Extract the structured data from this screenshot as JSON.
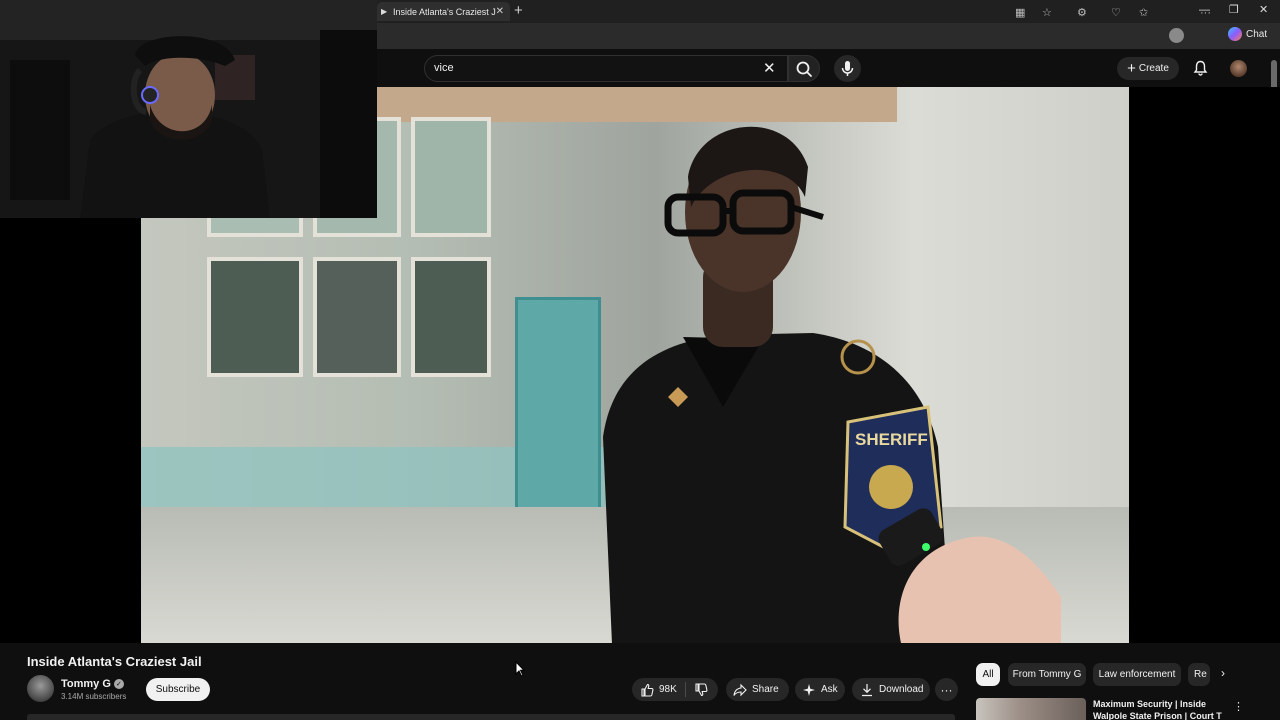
{
  "browser": {
    "tab": {
      "title": "Inside Atlanta's Craziest Jail",
      "favicon": "youtube-favicon",
      "close_glyph": "✕"
    },
    "new_tab_glyph": "+",
    "window_controls": [
      "—",
      "❐",
      "✕"
    ],
    "toolbar_icons": [
      "immersive-reader-icon",
      "favorite-star-icon",
      "extensions-icon",
      "browser-essentials-icon",
      "favorites-icon",
      "profile-icon",
      "settings-more-icon"
    ],
    "copilot_label": "Chat"
  },
  "youtube": {
    "search": {
      "value": "vice",
      "clear_glyph": "✕"
    },
    "create_label": "Create",
    "create_plus": "+"
  },
  "video": {
    "title": "Inside Atlanta's Craziest Jail",
    "channel": {
      "name": "Tommy G",
      "subscribers": "3.14M subscribers",
      "verified_glyph": "✓"
    },
    "subscribe_label": "Subscribe",
    "actions": {
      "likes": "98K",
      "share": "Share",
      "ask": "Ask",
      "download": "Download",
      "more": "···"
    },
    "patch_text": "SHERIFF"
  },
  "sidebar": {
    "chips": [
      "All",
      "From Tommy G",
      "Law enforcement",
      "Re"
    ],
    "chip_next": "›",
    "recommendation": {
      "title_line1": "Maximum Security | Inside",
      "title_line2": "Walpole State Prison | Court T",
      "more": "⋮"
    }
  },
  "colors": {
    "background": "#0f0f0f",
    "pill": "#272727",
    "text": "#f1f1f1",
    "subtext": "#aaaaaa",
    "subscribe_bg": "#f1f1f1"
  }
}
